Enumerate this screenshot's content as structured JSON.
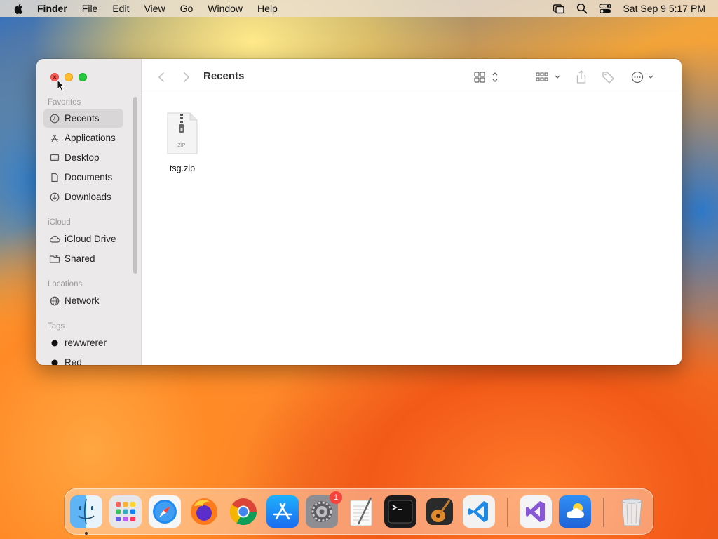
{
  "menubar": {
    "app_name": "Finder",
    "menus": [
      "File",
      "Edit",
      "View",
      "Go",
      "Window",
      "Help"
    ],
    "clock": "Sat Sep 9  5:17 PM",
    "status_icons": [
      "screen-mirroring-icon",
      "spotlight-search-icon",
      "control-center-icon"
    ]
  },
  "window": {
    "title": "Recents",
    "sidebar": {
      "favorites_title": "Favorites",
      "favorites": [
        {
          "label": "Recents",
          "icon": "clock-icon"
        },
        {
          "label": "Applications",
          "icon": "applications-icon"
        },
        {
          "label": "Desktop",
          "icon": "desktop-icon"
        },
        {
          "label": "Documents",
          "icon": "document-icon"
        },
        {
          "label": "Downloads",
          "icon": "download-icon"
        }
      ],
      "icloud_title": "iCloud",
      "icloud": [
        {
          "label": "iCloud Drive",
          "icon": "cloud-icon"
        },
        {
          "label": "Shared",
          "icon": "shared-folder-icon"
        }
      ],
      "locations_title": "Locations",
      "locations": [
        {
          "label": "Network",
          "icon": "globe-icon"
        }
      ],
      "tags_title": "Tags",
      "tags": [
        {
          "label": "rewwrerer",
          "color": "#111111"
        },
        {
          "label": "Red",
          "color": "#111111"
        }
      ]
    },
    "files": [
      {
        "name": "tsg.zip",
        "type_label": "ZIP"
      }
    ]
  },
  "dock": {
    "apps": [
      "Finder",
      "Launchpad",
      "Safari",
      "Firefox",
      "Chrome",
      "App Store",
      "System Settings",
      "TextEdit",
      "Terminal",
      "GarageBand",
      "Visual Studio Code",
      "Visual Studio",
      "Weather",
      "Trash"
    ],
    "settings_badge": "1"
  },
  "colors": {
    "accent_close": "#fe5f57",
    "accent_minimize": "#febc2e",
    "accent_maximize": "#28c840"
  }
}
